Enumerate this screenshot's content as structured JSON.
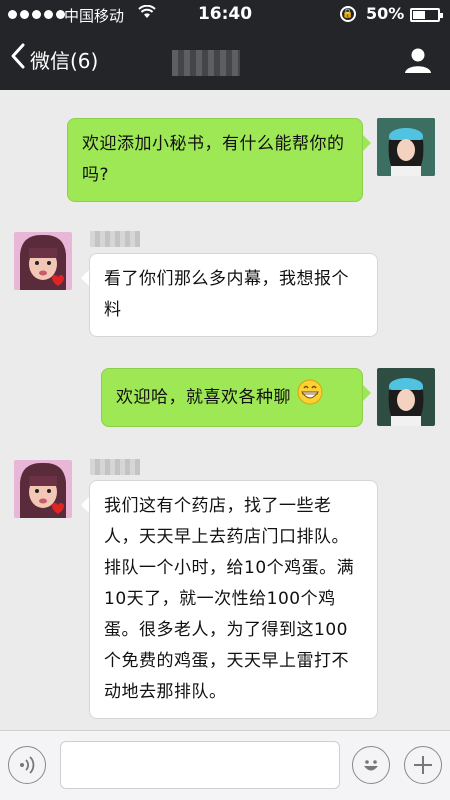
{
  "status_bar": {
    "carrier": "中国移动",
    "time": "16:40",
    "battery_percent": "50%",
    "battery_level": 0.5,
    "signal_dots": 5
  },
  "nav": {
    "back_label": "微信(6)"
  },
  "messages": [
    {
      "direction": "outgoing",
      "text": "欢迎添加小秘书，有什么能帮你的吗?"
    },
    {
      "direction": "incoming",
      "text": "看了你们那么多内幕，我想报个料"
    },
    {
      "direction": "outgoing",
      "text": "欢迎哈，就喜欢各种聊",
      "emoji": "grinning-face-icon"
    },
    {
      "direction": "incoming",
      "text": "我们这有个药店，找了一些老人，天天早上去药店门口排队。排队一个小时，给10个鸡蛋。满10天了，就一次性给100个鸡蛋。很多老人，为了得到这100个免费的鸡蛋，天天早上雷打不动地去那排队。"
    }
  ],
  "input_bar": {
    "placeholder": "",
    "icons": [
      "voice-icon",
      "emoji-icon",
      "plus-icon"
    ]
  },
  "colors": {
    "header_bg": "#242529",
    "chat_bg": "#ebebeb",
    "outgoing_bubble": "#9ee755",
    "incoming_bubble": "#ffffff"
  }
}
